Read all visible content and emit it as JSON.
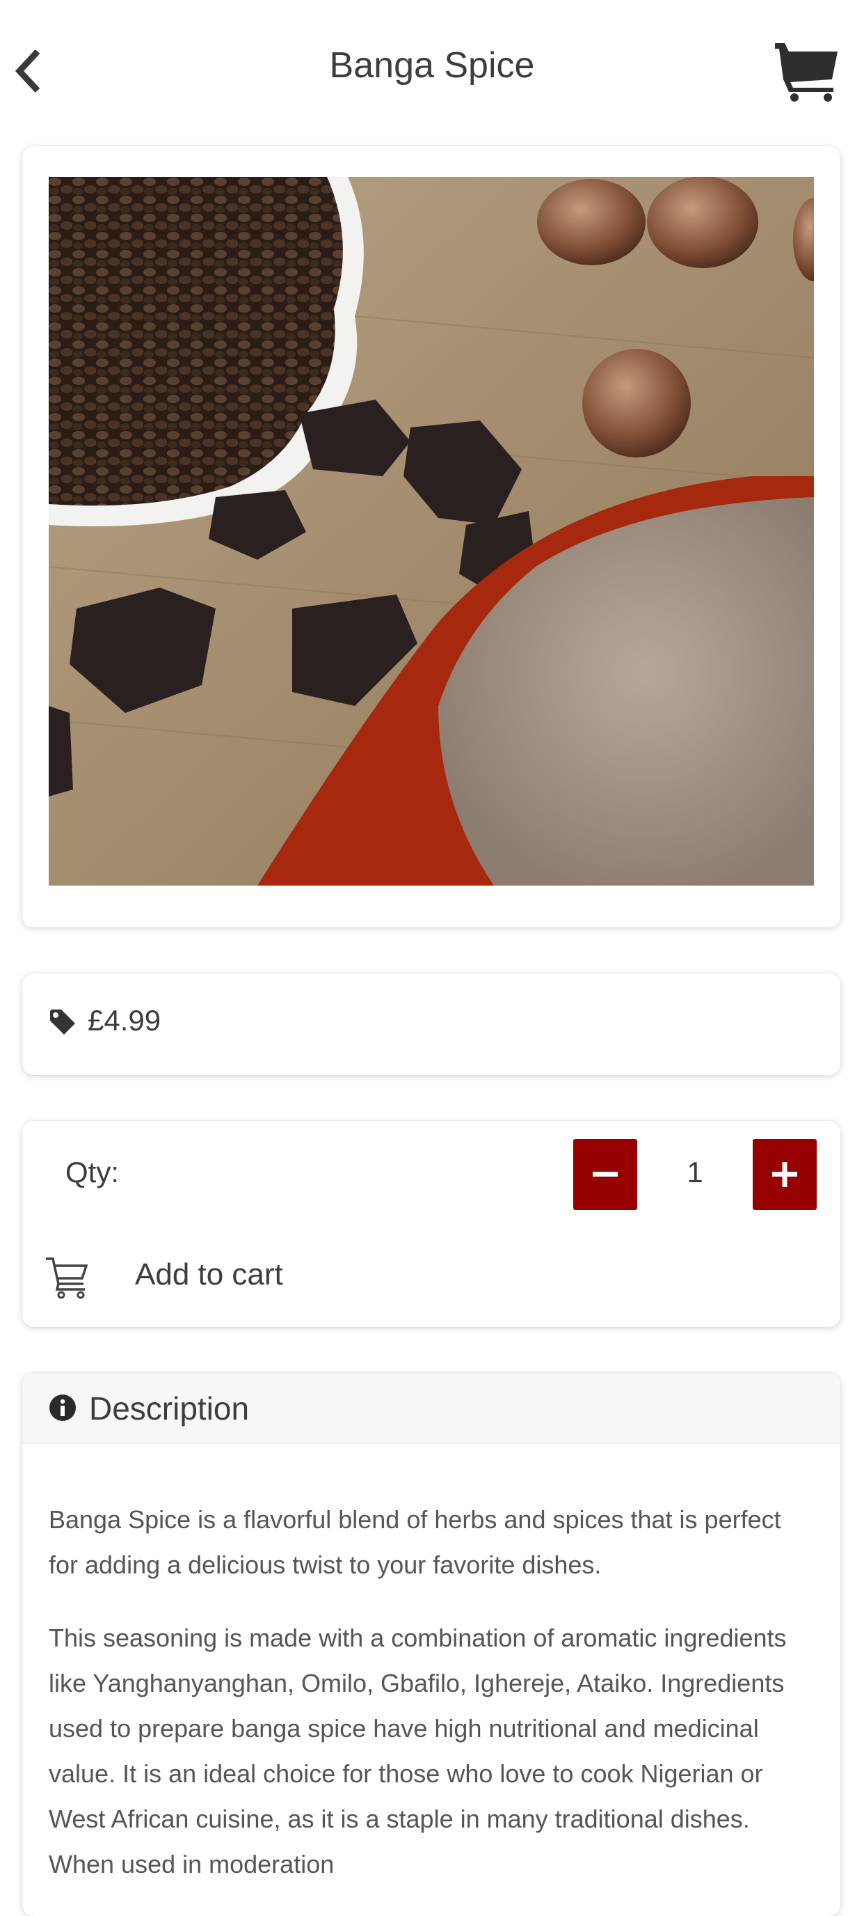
{
  "header": {
    "title": "Banga Spice",
    "back_icon": "chevron-left-icon",
    "cart_icon": "shopping-cart-icon"
  },
  "product": {
    "image_alt": "Banga Spice",
    "price": "£4.99",
    "price_icon": "tag-icon"
  },
  "quantity": {
    "label": "Qty:",
    "value": "1",
    "minus_icon": "minus-icon",
    "plus_icon": "plus-icon"
  },
  "add_to_cart": {
    "label": "Add to cart",
    "icon": "cart-outline-icon"
  },
  "description": {
    "title": "Description",
    "icon": "info-circle-icon",
    "paragraphs": [
      "Banga Spice is a flavorful blend of herbs and spices that is perfect for adding a delicious twist to your favorite dishes.",
      "This seasoning is made with a combination of aromatic ingredients like Yanghanyanghan, Omilo, Gbafilo, Ighereje, Ataiko. Ingredients used to prepare banga spice have high nutritional and medicinal value. It is an ideal choice for those who love to cook Nigerian or West African cuisine, as it is a staple in many traditional dishes. When used in moderation"
    ]
  },
  "colors": {
    "accent": "#960000",
    "text": "#3d3d3d",
    "card_header_bg": "#f7f7f7"
  }
}
